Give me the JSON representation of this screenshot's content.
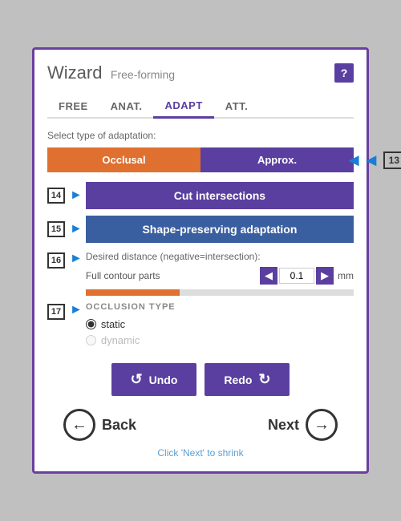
{
  "wizard": {
    "title": "Wizard",
    "subtitle": "Free-forming",
    "help_label": "?",
    "tabs": [
      {
        "id": "free",
        "label": "FREE",
        "active": false
      },
      {
        "id": "anat",
        "label": "ANAT.",
        "active": false
      },
      {
        "id": "adapt",
        "label": "ADAPT",
        "active": true
      },
      {
        "id": "att",
        "label": "ATT.",
        "active": false
      }
    ],
    "section_label": "Select type of adaptation:",
    "btn_occlusal": "Occlusal",
    "btn_approx": "Approx.",
    "badge_13": "13",
    "badge_14": "14",
    "badge_15": "15",
    "badge_16": "16",
    "badge_17": "17",
    "btn_cut_intersections": "Cut intersections",
    "btn_shape_preserving": "Shape-preserving adaptation",
    "desired_distance_label": "Desired distance (negative=intersection):",
    "full_contour_label": "Full contour parts",
    "distance_value": "0.1",
    "distance_unit": "mm",
    "occlusion_type_title": "OCCLUSION TYPE",
    "radio_static": "static",
    "radio_dynamic": "dynamic",
    "btn_undo": "Undo",
    "btn_redo": "Redo",
    "btn_back": "Back",
    "btn_next": "Next",
    "click_hint": "Click 'Next' to shrink"
  }
}
